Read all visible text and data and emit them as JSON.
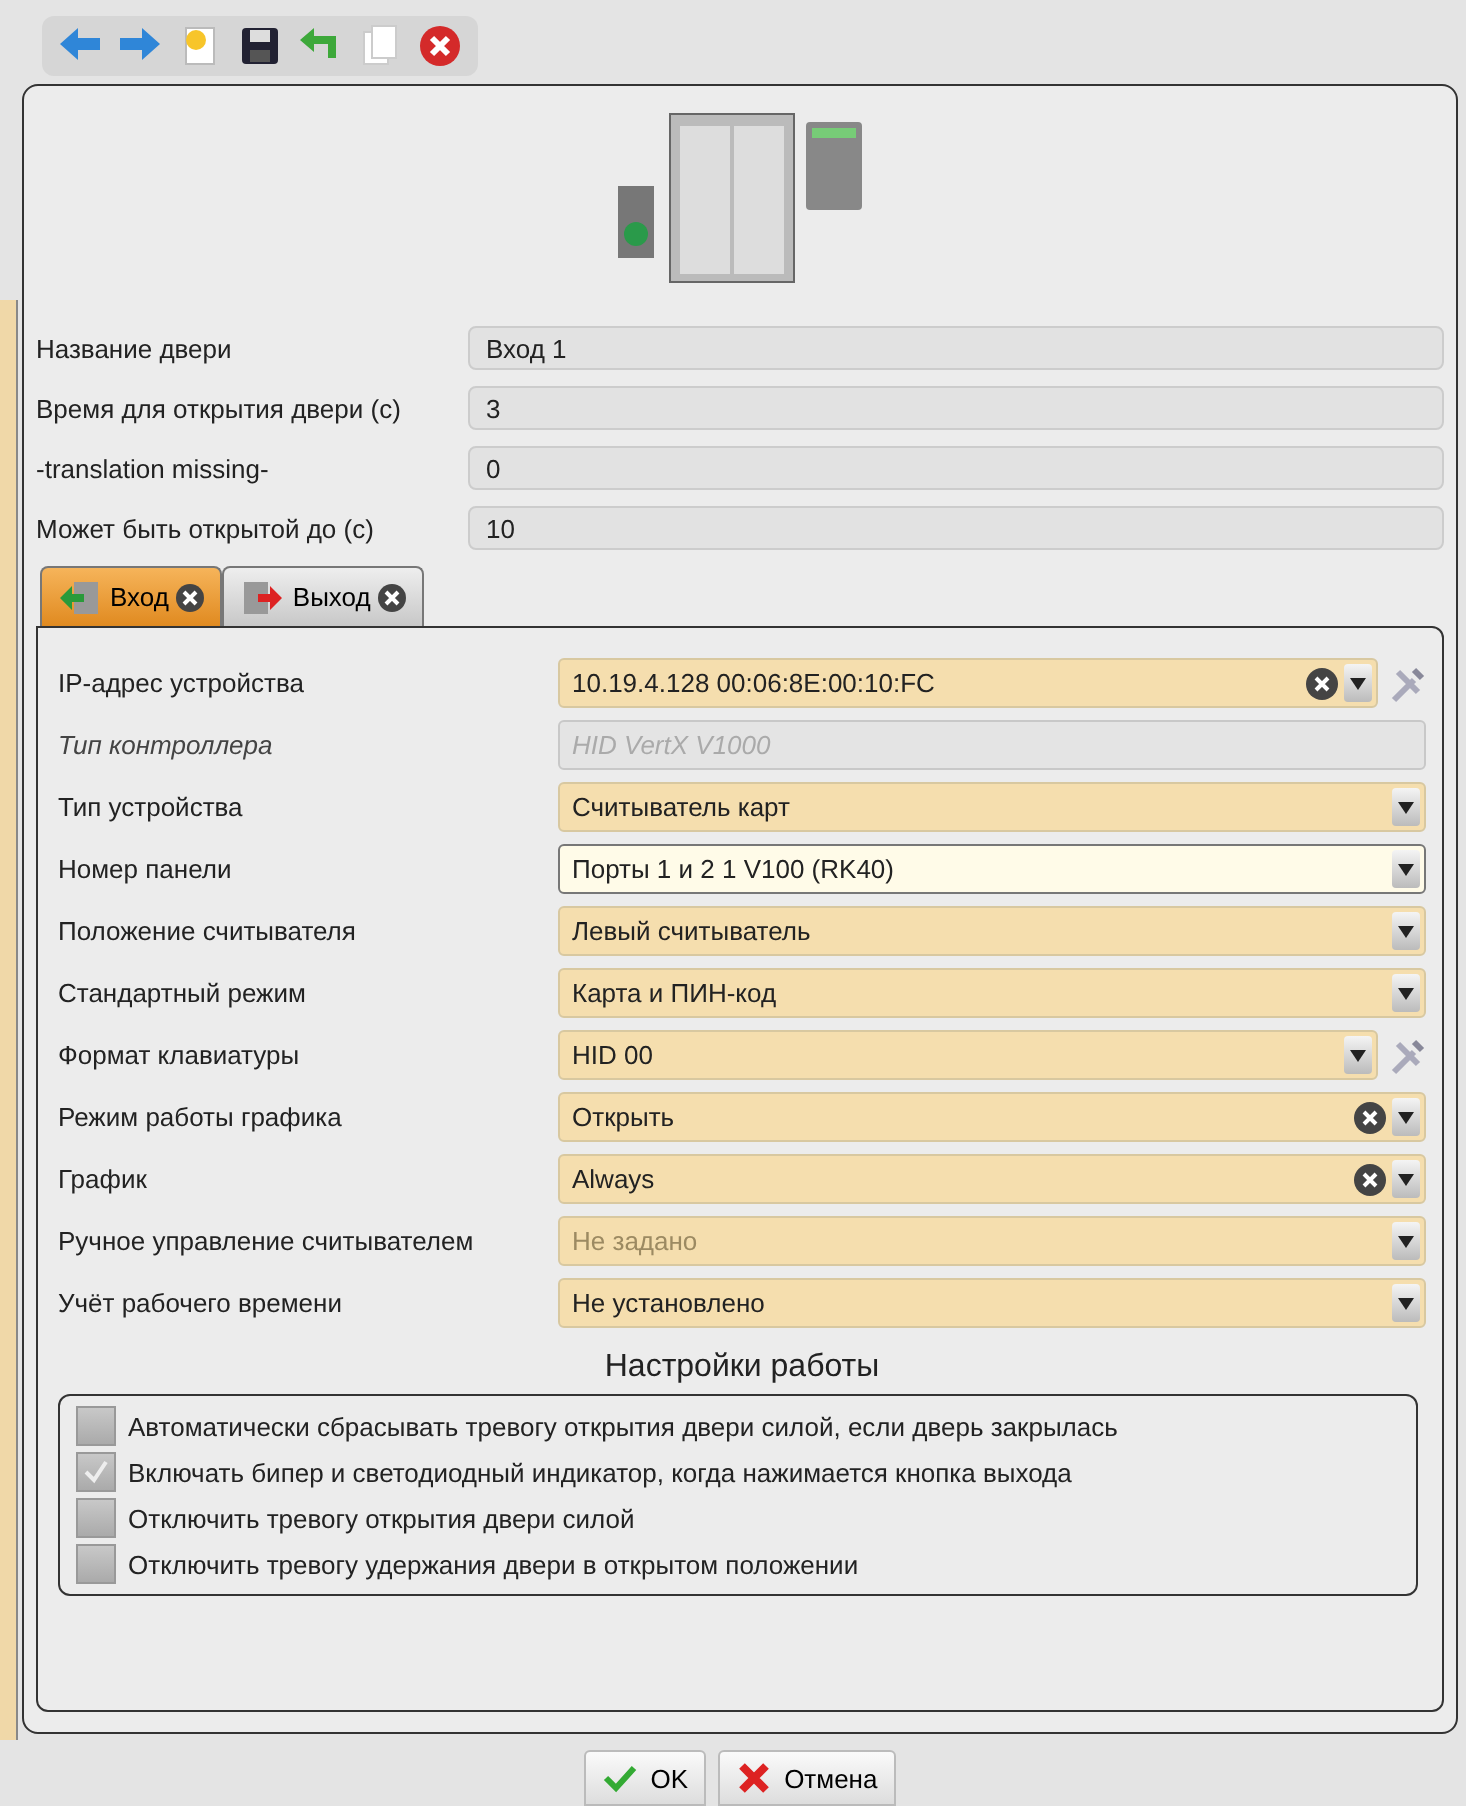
{
  "door_fields": [
    {
      "label": "Название двери",
      "value": "Вход 1"
    },
    {
      "label": "Время для открытия двери (с)",
      "value": "3"
    },
    {
      "label": "-translation missing-",
      "value": "0"
    },
    {
      "label": "Может быть открытой до (с)",
      "value": "10"
    }
  ],
  "tabs": [
    {
      "label": "Вход",
      "selected": true,
      "kind": "entry"
    },
    {
      "label": "Выход",
      "selected": false,
      "kind": "exit"
    }
  ],
  "device_fields": [
    {
      "label": "IP-адрес устройства",
      "value": "10.19.4.128 00:06:8E:00:10:FC",
      "kind": "combo",
      "clearable": true,
      "tool": true
    },
    {
      "label": "Тип контроллера",
      "value": "HID VertX V1000",
      "kind": "readonly"
    },
    {
      "label": "Тип устройства",
      "value": "Считыватель карт",
      "kind": "combo"
    },
    {
      "label": "Номер панели",
      "value": "Порты 1 и 2 1 V100 (RK40)",
      "kind": "combo",
      "focused": true
    },
    {
      "label": "Положение считывателя",
      "value": "Левый считыватель",
      "kind": "combo"
    },
    {
      "label": "Стандартный режим",
      "value": "Карта и ПИН-код",
      "kind": "combo"
    },
    {
      "label": "Формат клавиатуры",
      "value": "HID 00",
      "kind": "combo",
      "tool": true
    },
    {
      "label": "Режим работы графика",
      "value": "Открыть",
      "kind": "combo",
      "clearable": true
    },
    {
      "label": "График",
      "value": "Always",
      "kind": "combo",
      "clearable": true
    },
    {
      "label": "Ручное управление считывателем",
      "placeholder": "Не задано",
      "kind": "combo"
    },
    {
      "label": "Учёт рабочего времени",
      "value": "Не установлено",
      "kind": "combo"
    }
  ],
  "settings": {
    "title": "Настройки работы",
    "options": [
      {
        "label": "Автоматически сбрасывать тревогу открытия двери силой, если дверь закрылась",
        "checked": false
      },
      {
        "label": "Включать бипер и светодиодный индикатор, когда нажимается кнопка выхода",
        "checked": true
      },
      {
        "label": "Отключить тревогу открытия двери силой",
        "checked": false
      },
      {
        "label": "Отключить тревогу удержания двери в открытом положении",
        "checked": false
      }
    ]
  },
  "buttons": [
    {
      "label": "OK",
      "kind": "ok"
    },
    {
      "label": "Отмена",
      "kind": "cancel"
    }
  ]
}
